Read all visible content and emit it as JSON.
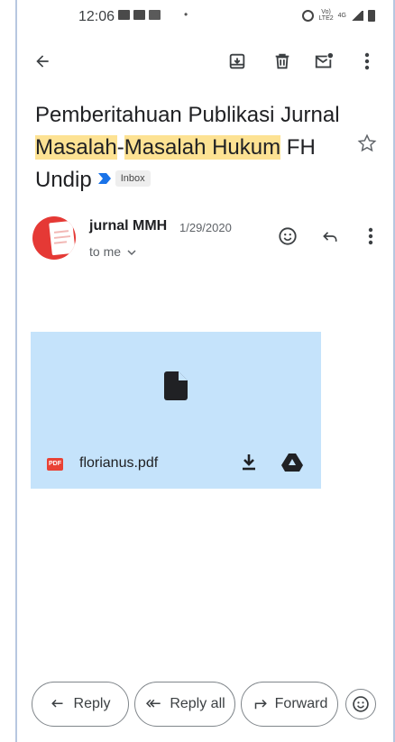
{
  "status_bar": {
    "time": "12:06",
    "dot": "•",
    "network_top": "Vo)",
    "network_bottom": "LTE2",
    "network_type": "4G"
  },
  "toolbar": {
    "icons": [
      "back-arrow-icon",
      "archive-icon",
      "delete-icon",
      "mark-unread-icon",
      "more-vert-icon"
    ]
  },
  "subject": {
    "part1": "Pemberitahuan Publikasi Jurnal",
    "hl1": "Masalah",
    "dash": "-",
    "hl2": "Masalah Hukum",
    "part2": " FH",
    "part3": "Undip",
    "label": "Inbox"
  },
  "message": {
    "sender": "jurnal MMH",
    "date": "1/29/2020",
    "recipient": "to me"
  },
  "attachment": {
    "type": "PDF",
    "filename": "florianus.pdf"
  },
  "actions": {
    "reply": "Reply",
    "reply_all": "Reply all",
    "forward": "Forward"
  },
  "colors": {
    "highlight": "#fde293",
    "attachment_bg": "#c5e3fb",
    "avatar": "#e53935",
    "important": "#1a73e8"
  }
}
